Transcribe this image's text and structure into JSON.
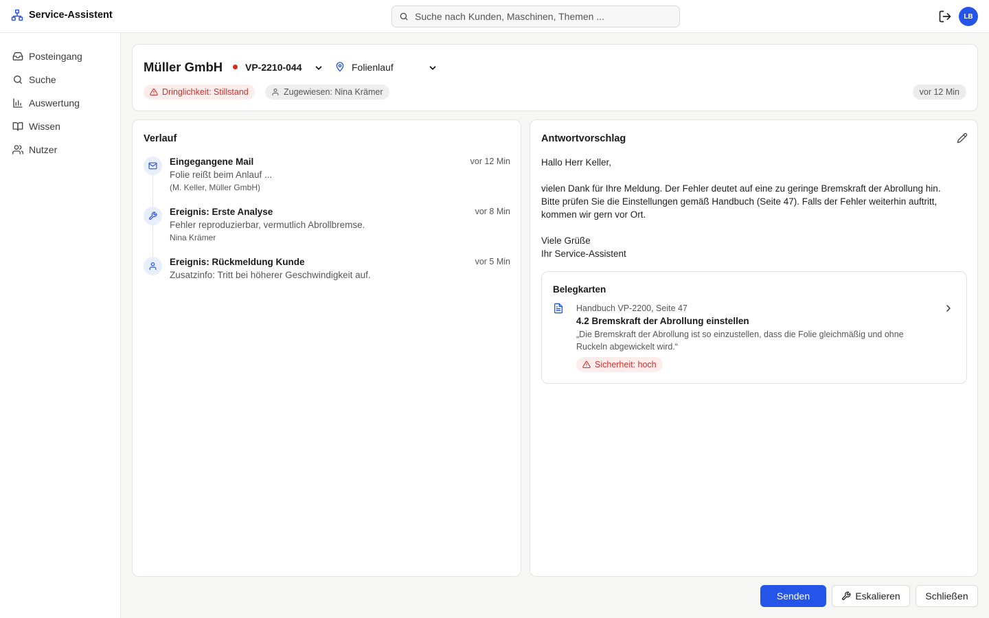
{
  "app": {
    "title": "Service-Assistent"
  },
  "search": {
    "placeholder": "Suche nach Kunden, Maschinen, Themen ..."
  },
  "user": {
    "initials": "LB"
  },
  "sidebar": {
    "items": [
      {
        "label": "Posteingang",
        "icon": "inbox-icon"
      },
      {
        "label": "Suche",
        "icon": "search-icon"
      },
      {
        "label": "Auswertung",
        "icon": "bar-chart-icon"
      },
      {
        "label": "Wissen",
        "icon": "book-icon"
      },
      {
        "label": "Nutzer",
        "icon": "users-icon"
      }
    ]
  },
  "ticket": {
    "customer": "Müller GmbH",
    "machine": "VP-2210-044",
    "topic": "Folienlauf",
    "urgency": "Dringlichkeit: Stillstand",
    "assigned": "Zugewiesen: Nina Krämer",
    "age": "vor 12 Min",
    "status_color": "#d92d20"
  },
  "history": {
    "title": "Verlauf",
    "events": [
      {
        "icon": "mail-icon",
        "title": "Eingegangene Mail",
        "time": "vor 12 Min",
        "text": "Folie reißt beim Anlauf ...",
        "sub": "(M. Keller, Müller GmbH)"
      },
      {
        "icon": "wrench-icon",
        "title": "Ereignis: Erste Analyse",
        "time": "vor 8 Min",
        "text": "Fehler reproduzierbar, vermutlich Abrollbremse.",
        "sub": "Nina Krämer"
      },
      {
        "icon": "user-icon",
        "title": "Ereignis: Rückmeldung Kunde",
        "time": "vor 5 Min",
        "text": "Zusatzinfo: Tritt bei höherer Geschwindigkeit auf.",
        "sub": ""
      }
    ]
  },
  "reply": {
    "title": "Antwortvorschlag",
    "greeting": "Hallo Herr Keller,",
    "body_1": "vielen Dank für Ihre Meldung. Der Fehler deutet auf eine zu geringe Bremskraft der Abrollung hin.",
    "body_2": "Bitte prüfen Sie die Einstellungen gemäß Handbuch (Seite 47). Falls der Fehler weiterhin auftritt,",
    "body_3": "kommen wir gern vor Ort.",
    "closing_1": "Viele Grüße",
    "closing_2": "Ihr Service-Assistent"
  },
  "evidence": {
    "title": "Belegkarten",
    "source": "Handbuch VP-2200, Seite 47",
    "heading": "4.2 Bremskraft der Abrollung einstellen",
    "quote": "„Die Bremskraft der Abrollung ist so einzustellen, dass die Folie gleichmäßig und ohne Ruckeln abgewickelt wird.“",
    "confidence": "Sicherheit: hoch"
  },
  "actions": {
    "send": "Senden",
    "escalate": "Eskalieren",
    "close": "Schließen"
  },
  "colors": {
    "accent": "#2554e8",
    "danger": "#d0312d"
  }
}
